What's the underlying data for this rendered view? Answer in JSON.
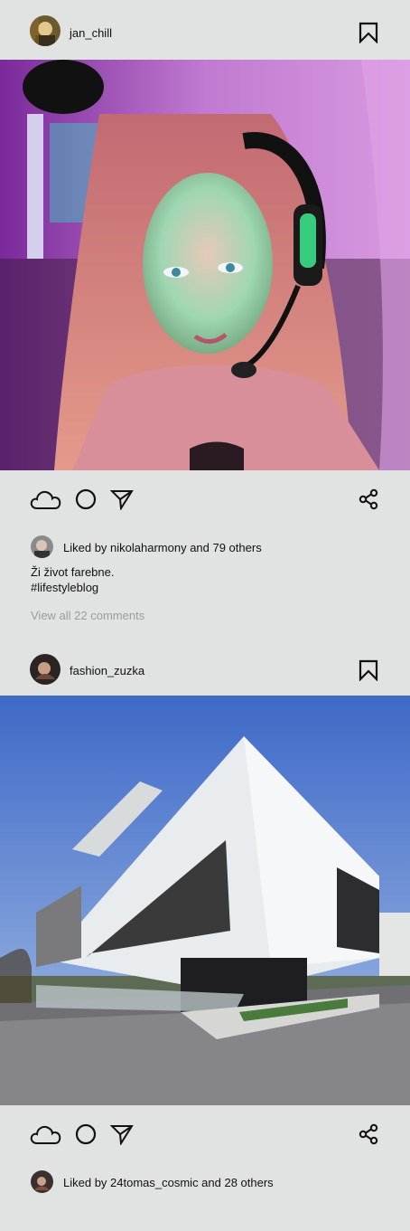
{
  "posts": [
    {
      "username": "jan_chill",
      "likes_text": "Liked by nikolaharmony and 79 others",
      "caption_lines": [
        "Ži život farebne.",
        "#lifestyleblog"
      ],
      "comments_link": "View all 22 comments",
      "photo_icon": "woman-gamer-headset-photo"
    },
    {
      "username": "fashion_zuzka",
      "likes_text": "Liked by 24tomas_cosmic and 28 others",
      "photo_icon": "modern-house-architecture-photo"
    }
  ],
  "icons": {
    "like": "cloud-icon",
    "comment": "circle-icon",
    "send": "send-icon",
    "share": "share-icon",
    "save": "bookmark-icon"
  },
  "colors": {
    "background": "#e0e3e1",
    "text": "#111111",
    "muted": "#9a9d9c"
  }
}
